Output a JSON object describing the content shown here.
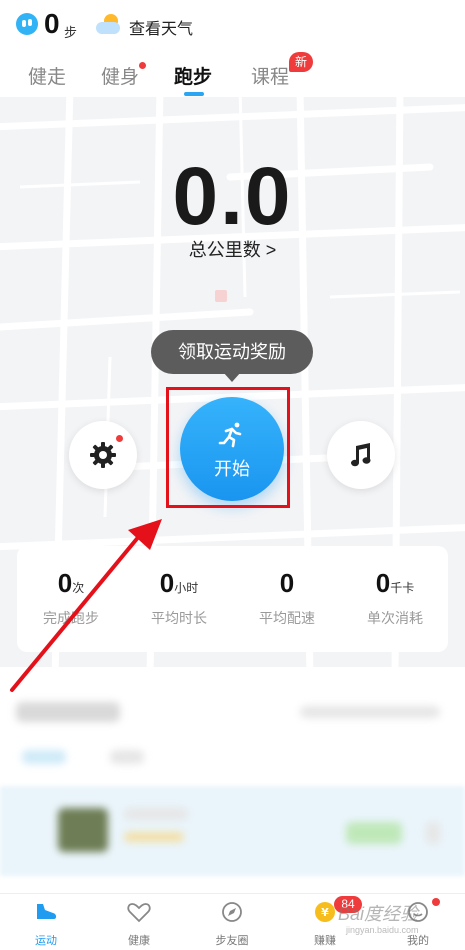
{
  "header": {
    "steps_value": "0",
    "steps_unit": "步",
    "weather_label": "查看天气"
  },
  "tabs": [
    {
      "label": "健走"
    },
    {
      "label": "健身"
    },
    {
      "label": "跑步"
    },
    {
      "label": "课程"
    }
  ],
  "course_badge": "新",
  "run": {
    "distance": "0.0",
    "distance_label": "总公里数 >",
    "tooltip": "领取运动奖励",
    "start_label": "开始"
  },
  "stats": [
    {
      "value": "0",
      "unit": "次",
      "label": "完成跑步"
    },
    {
      "value": "0",
      "unit": "小时",
      "label": "平均时长"
    },
    {
      "value": "0",
      "unit": "",
      "label": "平均配速"
    },
    {
      "value": "0",
      "unit": "千卡",
      "label": "单次消耗"
    }
  ],
  "bottom_nav": [
    {
      "label": "运动",
      "icon": "sport-shoe-icon"
    },
    {
      "label": "健康",
      "icon": "heart-icon"
    },
    {
      "label": "步友圈",
      "icon": "compass-icon"
    },
    {
      "label": "赚赚",
      "icon": "coin-icon"
    },
    {
      "label": "我的",
      "icon": "profile-icon"
    }
  ],
  "earn_badge": "84",
  "watermark": {
    "main": "Bai度经验",
    "sub": "jingyan.baidu.com"
  },
  "colors": {
    "accent": "#1f9bf0",
    "badge_red": "#ef3b3b",
    "annotation_red": "#e4111b"
  }
}
